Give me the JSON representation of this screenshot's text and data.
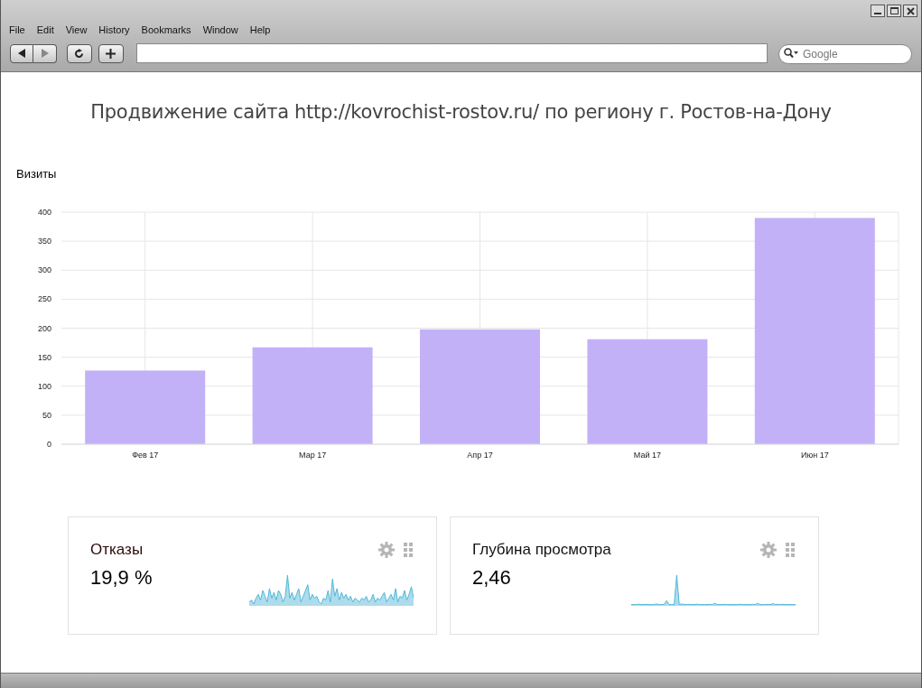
{
  "window": {
    "menu": [
      "File",
      "Edit",
      "View",
      "History",
      "Bookmarks",
      "Window",
      "Help"
    ]
  },
  "toolbar": {
    "search": {
      "placeholder": "Google"
    }
  },
  "page": {
    "title": "Продвижение сайта http://kovrochist-rostov.ru/ по региону г. Ростов-на-Дону",
    "chart": {
      "title": "Визиты",
      "chart_data": {
        "type": "bar",
        "categories": [
          "Фев 17",
          "Мар 17",
          "Апр 17",
          "Май 17",
          "Июн 17"
        ],
        "series": [
          {
            "color": "#c3b1f7",
            "values": [
              127,
              167,
              198,
              181,
              390
            ]
          }
        ],
        "grid": true,
        "ylim": [
          0,
          400
        ],
        "yticks": [
          0,
          50,
          100,
          150,
          200,
          250,
          300,
          350,
          400
        ]
      }
    },
    "cards": [
      {
        "title": "Отказы",
        "value": "19,9 %"
      },
      {
        "title": "Глубина просмотра",
        "value": "2,46"
      }
    ]
  }
}
